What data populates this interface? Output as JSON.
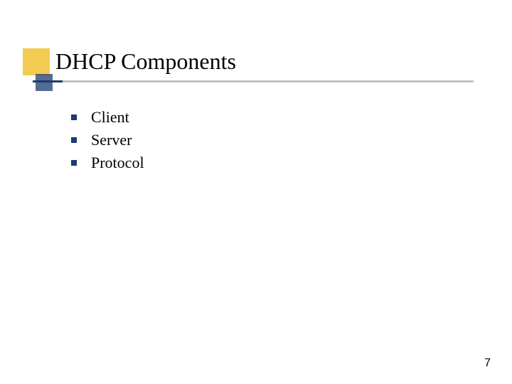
{
  "slide": {
    "title": "DHCP Components",
    "bullets": [
      {
        "text": "Client"
      },
      {
        "text": "Server"
      },
      {
        "text": "Protocol"
      }
    ],
    "page_number": "7"
  }
}
